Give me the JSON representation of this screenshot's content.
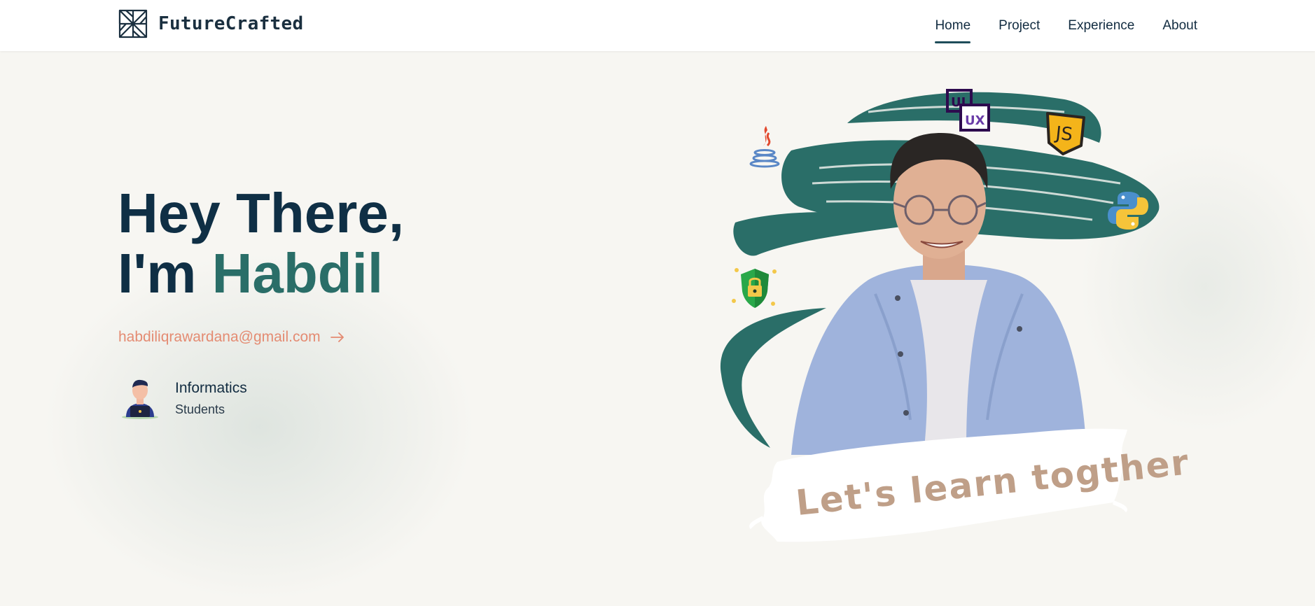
{
  "brand": {
    "name": "FutureCrafted"
  },
  "nav": {
    "items": [
      {
        "label": "Home",
        "active": true
      },
      {
        "label": "Project",
        "active": false
      },
      {
        "label": "Experience",
        "active": false
      },
      {
        "label": "About",
        "active": false
      }
    ]
  },
  "hero": {
    "line1": "Hey There,",
    "line2_prefix": "I'm ",
    "name": "Habdil",
    "email": "habdiliqrawardana@gmail.com",
    "role_title": "Informatics",
    "role_subtitle": "Students",
    "banner_text": "Let's learn togther"
  },
  "icons": [
    "pinwheel-logo-icon",
    "java-icon",
    "ui-ux-icon",
    "javascript-icon",
    "python-icon",
    "security-shield-icon",
    "arrow-right-icon",
    "student-laptop-avatar-icon"
  ],
  "colors": {
    "primary_dark": "#0f2f45",
    "accent_teal": "#2a6e68",
    "email_coral": "#e48b72",
    "background": "#f7f6f2",
    "banner_text": "#bf9f88"
  }
}
